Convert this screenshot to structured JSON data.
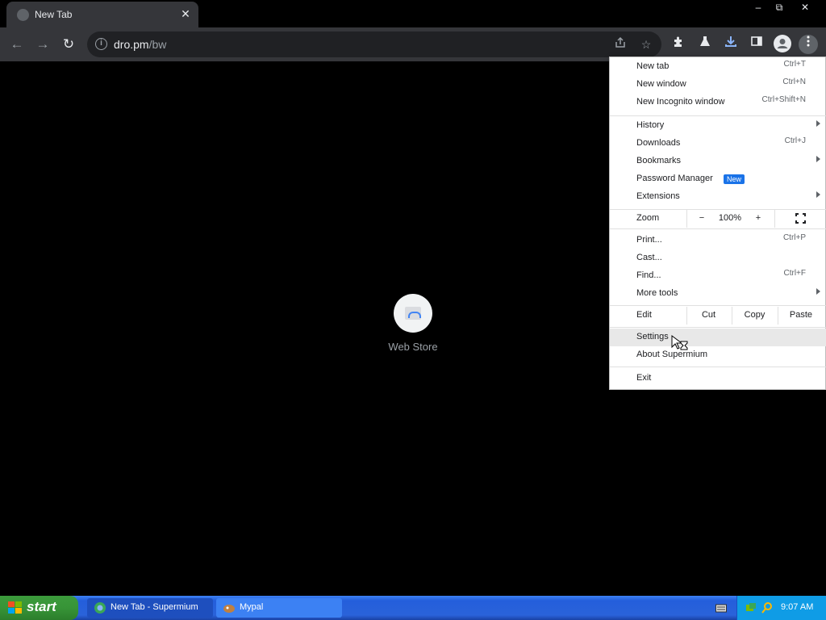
{
  "browser": {
    "tab_title": "New Tab",
    "tab_close": "✕",
    "window_controls": {
      "minimize": "‒",
      "restore": "⧉",
      "close": "✕"
    },
    "url_host": "dro.pm",
    "url_path": "/bw"
  },
  "content": {
    "shortcut_label": "Web Store"
  },
  "menu": {
    "new_tab": {
      "label": "New tab",
      "shortcut": "Ctrl+T"
    },
    "new_window": {
      "label": "New window",
      "shortcut": "Ctrl+N"
    },
    "new_incognito": {
      "label": "New Incognito window",
      "shortcut": "Ctrl+Shift+N"
    },
    "history": {
      "label": "History"
    },
    "downloads": {
      "label": "Downloads",
      "shortcut": "Ctrl+J"
    },
    "bookmarks": {
      "label": "Bookmarks"
    },
    "password_manager": {
      "label": "Password Manager",
      "badge": "New"
    },
    "extensions": {
      "label": "Extensions"
    },
    "zoom": {
      "label": "Zoom",
      "minus": "−",
      "value": "100%",
      "plus": "+"
    },
    "print": {
      "label": "Print...",
      "shortcut": "Ctrl+P"
    },
    "cast": {
      "label": "Cast..."
    },
    "find": {
      "label": "Find...",
      "shortcut": "Ctrl+F"
    },
    "more_tools": {
      "label": "More tools"
    },
    "edit": {
      "label": "Edit",
      "cut": "Cut",
      "copy": "Copy",
      "paste": "Paste"
    },
    "settings": {
      "label": "Settings"
    },
    "about": {
      "label": "About Supermium"
    },
    "exit": {
      "label": "Exit"
    }
  },
  "taskbar": {
    "start_label": "start",
    "tasks": [
      {
        "label": "New Tab - Supermium",
        "active": true
      },
      {
        "label": "Mypal",
        "active": false
      }
    ],
    "clock": "9:07 AM"
  }
}
